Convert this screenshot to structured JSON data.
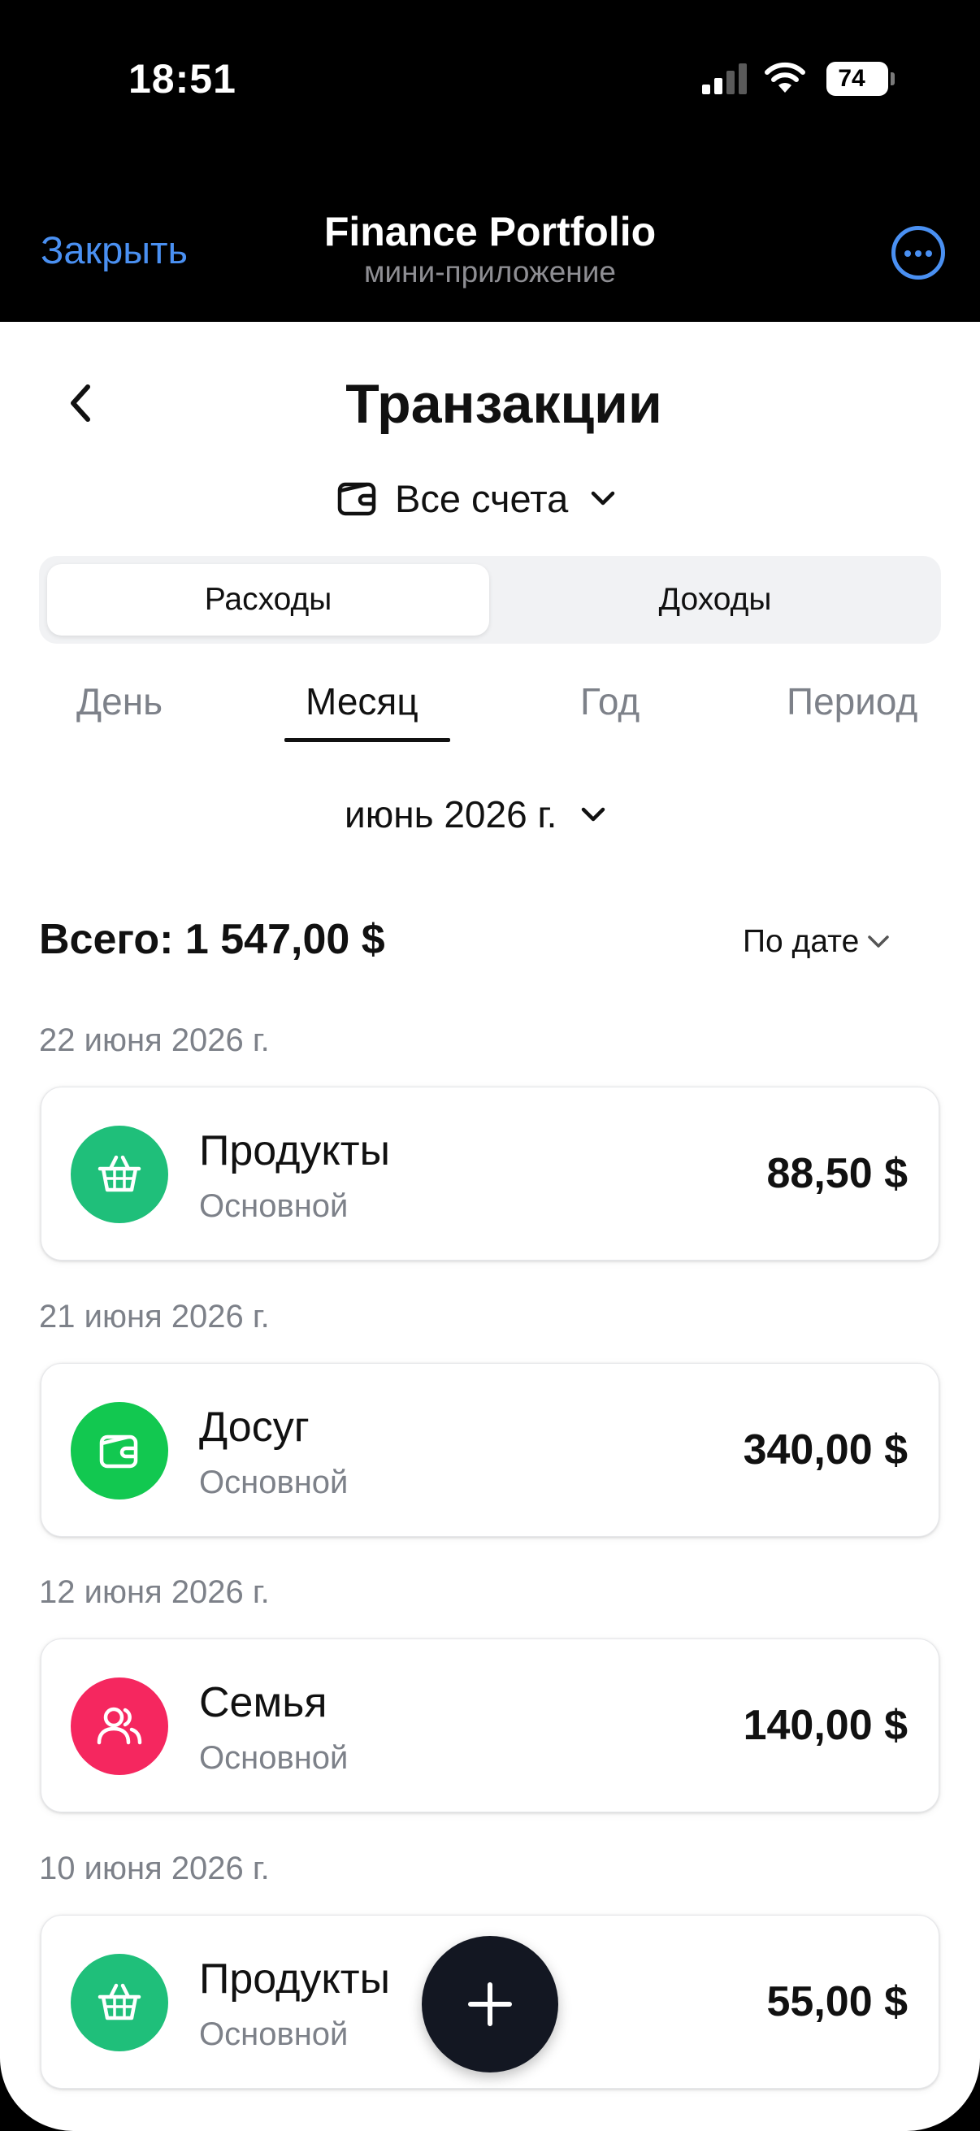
{
  "status_bar": {
    "time": "18:51",
    "battery": "74"
  },
  "header": {
    "close_label": "Закрыть",
    "title": "Finance Portfolio",
    "subtitle": "мини-приложение"
  },
  "page": {
    "title": "Транзакции",
    "account_selector": "Все счета"
  },
  "type_toggle": {
    "expenses": "Расходы",
    "income": "Доходы",
    "selected": "Расходы"
  },
  "period_tabs": [
    {
      "label": "День"
    },
    {
      "label": "Месяц"
    },
    {
      "label": "Год"
    },
    {
      "label": "Период"
    }
  ],
  "selected_period": "Месяц",
  "month": "июнь 2026 г.",
  "summary": {
    "total": "Всего: 1 547,00 $",
    "sort_label": "По дате"
  },
  "groups": [
    {
      "date": "22 июня 2026 г.",
      "category": "Продукты",
      "account": "Основной",
      "amount": "88,50 $",
      "icon": "basket-icon",
      "color": "#1fbf7a"
    },
    {
      "date": "21 июня 2026 г.",
      "category": "Досуг",
      "account": "Основной",
      "amount": "340,00 $",
      "icon": "wallet-icon",
      "color": "#12c850"
    },
    {
      "date": "12 июня 2026 г.",
      "category": "Семья",
      "account": "Основной",
      "amount": "140,00 $",
      "icon": "users-icon",
      "color": "#f5275f"
    },
    {
      "date": "10 июня 2026 г.",
      "category": "Продукты",
      "account": "Основной",
      "amount": "55,00 $",
      "icon": "basket-icon",
      "color": "#1fbf7a"
    }
  ],
  "colors": {
    "accent": "#4a90f2",
    "fab": "#131722"
  }
}
